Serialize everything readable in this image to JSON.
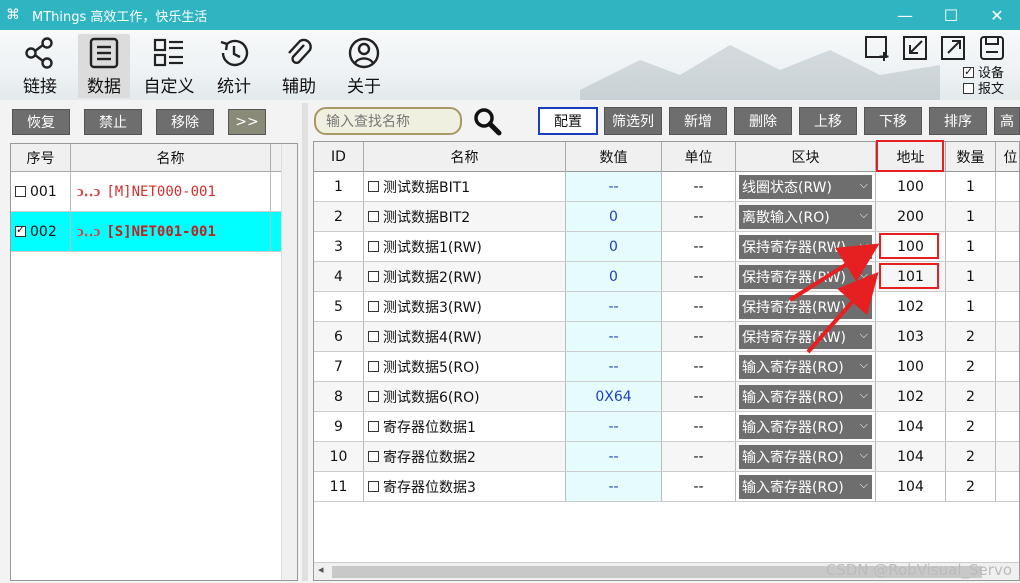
{
  "window": {
    "title": "MThings  高效工作，快乐生活",
    "minimize": "—",
    "maximize": "☐",
    "close": "✕"
  },
  "nav": [
    {
      "label": "链接",
      "icon": "share-icon"
    },
    {
      "label": "数据",
      "icon": "list-icon"
    },
    {
      "label": "自定义",
      "icon": "grid-list-icon"
    },
    {
      "label": "统计",
      "icon": "history-icon"
    },
    {
      "label": "辅助",
      "icon": "paperclip-icon"
    },
    {
      "label": "关于",
      "icon": "user-icon"
    }
  ],
  "options": {
    "device": "设备",
    "message": "报文"
  },
  "left": {
    "buttons": [
      "恢复",
      "禁止",
      "移除",
      ">>"
    ],
    "headers": [
      "序号",
      "名称"
    ],
    "rows": [
      {
        "index": "001",
        "name": "[M]NET000-001",
        "checked": false,
        "selected": false
      },
      {
        "index": "002",
        "name": "[S]NET001-001",
        "checked": true,
        "selected": true
      }
    ]
  },
  "search": {
    "placeholder": "输入查找名称"
  },
  "toolbar_buttons": [
    "配置",
    "筛选列",
    "新增",
    "删除",
    "上移",
    "下移",
    "排序",
    "高"
  ],
  "table": {
    "headers": [
      "ID",
      "名称",
      "数值",
      "单位",
      "区块",
      "地址",
      "数量",
      "位"
    ],
    "rows": [
      {
        "id": "1",
        "name": "测试数据BIT1",
        "value": "--",
        "unit": "--",
        "area": "线圈状态(RW)",
        "addr": "100",
        "qty": "1"
      },
      {
        "id": "2",
        "name": "测试数据BIT2",
        "value": "0",
        "unit": "--",
        "area": "离散输入(RO)",
        "addr": "200",
        "qty": "1"
      },
      {
        "id": "3",
        "name": "测试数据1(RW)",
        "value": "0",
        "unit": "--",
        "area": "保持寄存器(RW)",
        "addr": "100",
        "qty": "1"
      },
      {
        "id": "4",
        "name": "测试数据2(RW)",
        "value": "0",
        "unit": "--",
        "area": "保持寄存器(RW)",
        "addr": "101",
        "qty": "1"
      },
      {
        "id": "5",
        "name": "测试数据3(RW)",
        "value": "--",
        "unit": "--",
        "area": "保持寄存器(RW)",
        "addr": "102",
        "qty": "1"
      },
      {
        "id": "6",
        "name": "测试数据4(RW)",
        "value": "--",
        "unit": "--",
        "area": "保持寄存器(RW)",
        "addr": "103",
        "qty": "2"
      },
      {
        "id": "7",
        "name": "测试数据5(RO)",
        "value": "--",
        "unit": "--",
        "area": "输入寄存器(RO)",
        "addr": "100",
        "qty": "2"
      },
      {
        "id": "8",
        "name": "测试数据6(RO)",
        "value": "0X64",
        "unit": "--",
        "area": "输入寄存器(RO)",
        "addr": "102",
        "qty": "2"
      },
      {
        "id": "9",
        "name": "寄存器位数据1",
        "value": "--",
        "unit": "--",
        "area": "输入寄存器(RO)",
        "addr": "104",
        "qty": "2"
      },
      {
        "id": "10",
        "name": "寄存器位数据2",
        "value": "--",
        "unit": "--",
        "area": "输入寄存器(RO)",
        "addr": "104",
        "qty": "2"
      },
      {
        "id": "11",
        "name": "寄存器位数据3",
        "value": "--",
        "unit": "--",
        "area": "输入寄存器(RO)",
        "addr": "104",
        "qty": "2"
      }
    ]
  },
  "watermark": "CSDN @RobVisual_Servo",
  "colors": {
    "titlebar": "#2fb4c2",
    "selected_row": "#00ffff",
    "highlight": "#e62020",
    "value_bg": "#e6fcfc"
  }
}
